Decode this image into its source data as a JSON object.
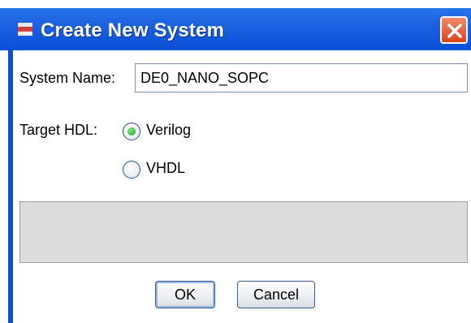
{
  "window": {
    "title": "Create New System",
    "titlebar_color": "#1e63e0",
    "close_icon": "close-icon"
  },
  "form": {
    "system_name_label": "System Name:",
    "system_name_value": "DE0_NANO_SOPC",
    "target_hdl_label": "Target HDL:",
    "hdl_options": [
      {
        "label": "Verilog",
        "selected": true
      },
      {
        "label": "VHDL",
        "selected": false
      }
    ]
  },
  "buttons": {
    "ok_label": "OK",
    "cancel_label": "Cancel"
  }
}
